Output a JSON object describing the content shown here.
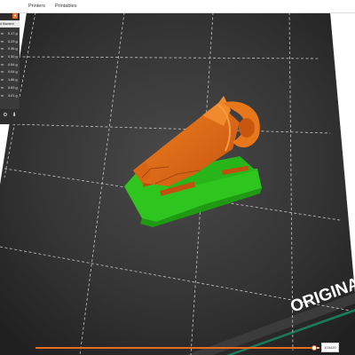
{
  "tabs": [
    "Printers",
    "Printables"
  ],
  "sidebar": {
    "header_arrow": "▾",
    "filament_label": "d filament",
    "rows": [
      {
        "label": "m",
        "value": "0.17 g"
      },
      {
        "label": "m",
        "value": "0.23 g"
      },
      {
        "label": "m",
        "value": "0.36 g"
      },
      {
        "label": "m",
        "value": "0.30 g"
      },
      {
        "label": "m",
        "value": "0.54 g"
      },
      {
        "label": "m",
        "value": "0.04 g"
      },
      {
        "label": "m",
        "value": "1.86 g"
      },
      {
        "label": "m",
        "value": "0.63 g"
      },
      {
        "label": "m",
        "value": "3.01 g"
      }
    ],
    "icons": [
      "settings-icon",
      "export-icon"
    ]
  },
  "bed": {
    "logo_text": "ORIGINAL",
    "colors": {
      "bed_dark": "#232323",
      "bed_mid": "#383838",
      "grid": "#bdbdbd",
      "part_orange": "#e06a17",
      "part_green": "#2ec51e",
      "support": "#c24f0e"
    }
  },
  "layer_slider": {
    "position": 0.98,
    "value": "103420"
  }
}
